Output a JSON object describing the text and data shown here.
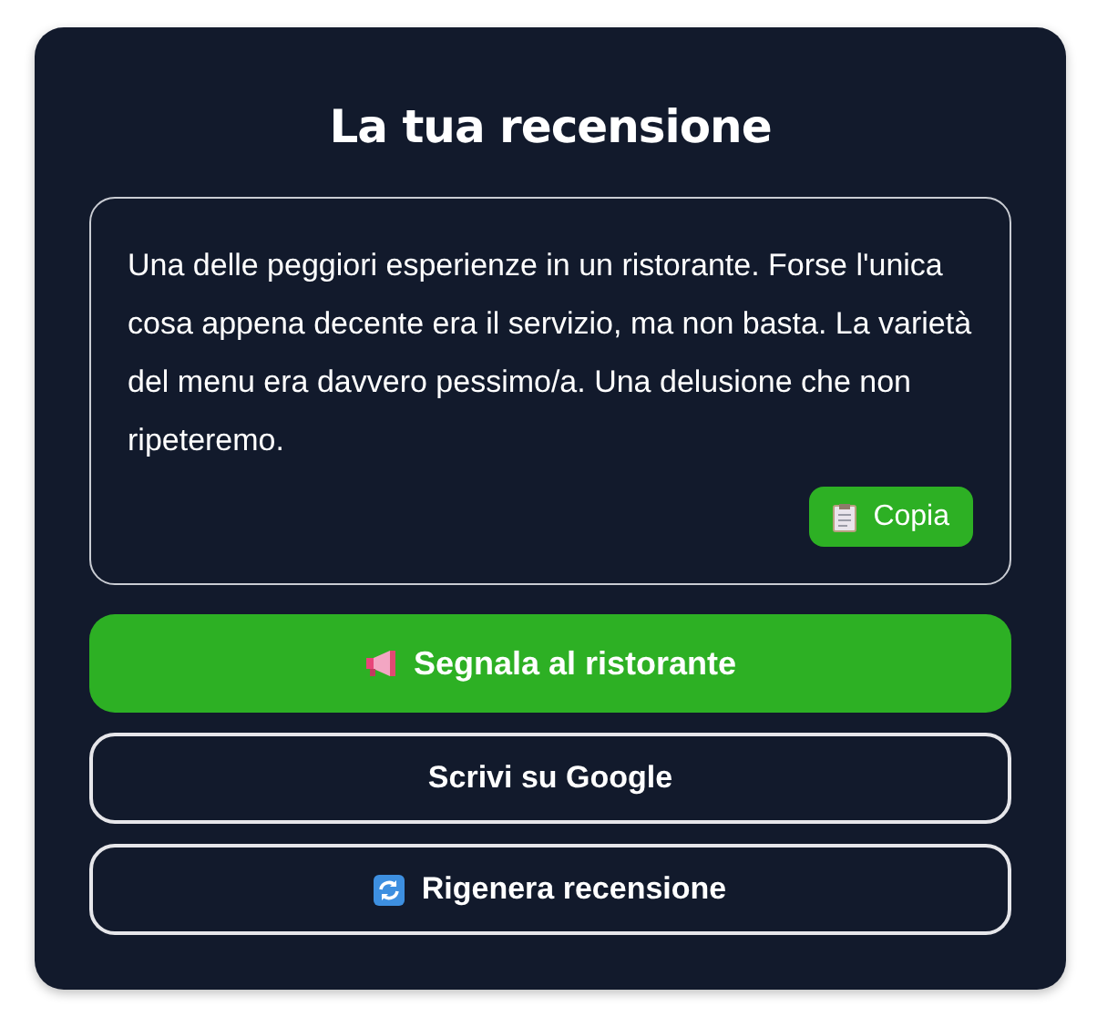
{
  "title": "La tua recensione",
  "review": {
    "text": "Una delle peggiori esperienze in un ristorante. Forse l'unica cosa appena decente era il servizio, ma non basta. La varietà del menu era davvero pessimo/a. Una delusione che non ripeteremo.",
    "copy_button": "Copia"
  },
  "buttons": [
    {
      "label": "Segnala al ristorante",
      "kind": "primary"
    },
    {
      "label": "Scrivi su Google",
      "kind": "outline"
    },
    {
      "label": "Rigenera recensione",
      "kind": "outline"
    }
  ]
}
